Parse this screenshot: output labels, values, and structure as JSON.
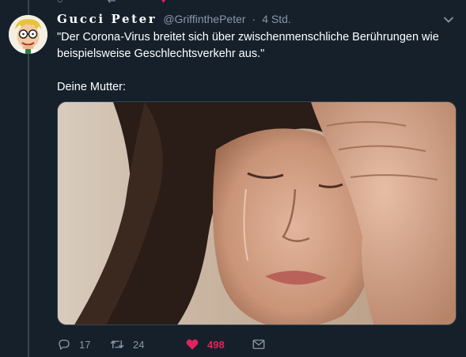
{
  "tweet": {
    "author": {
      "display_name": "Gucci Peter",
      "handle": "@GriffinthePeter",
      "avatar": "cartoon-avatar"
    },
    "separator": "·",
    "time": "4 Std.",
    "text_line1": "\"Der Corona-Virus breitet sich über zwischenmenschliche Berührungen wie beispielsweise Geschlechtsverkehr aus.\"",
    "text_line2": "Deine Mutter:",
    "media": {
      "type": "photo",
      "subject": "crying woman with hand on forehead"
    },
    "actions": {
      "reply_count": "17",
      "retweet_count": "24",
      "like_count": "498",
      "liked": true
    }
  },
  "icons": {
    "reply": "reply-icon",
    "retweet": "retweet-icon",
    "like": "heart-icon",
    "dm": "envelope-icon",
    "menu": "chevron-down-icon"
  },
  "colors": {
    "background": "#15202b",
    "secondary_text": "#8899a6",
    "like_red": "#e0245e",
    "border": "#38444d"
  }
}
